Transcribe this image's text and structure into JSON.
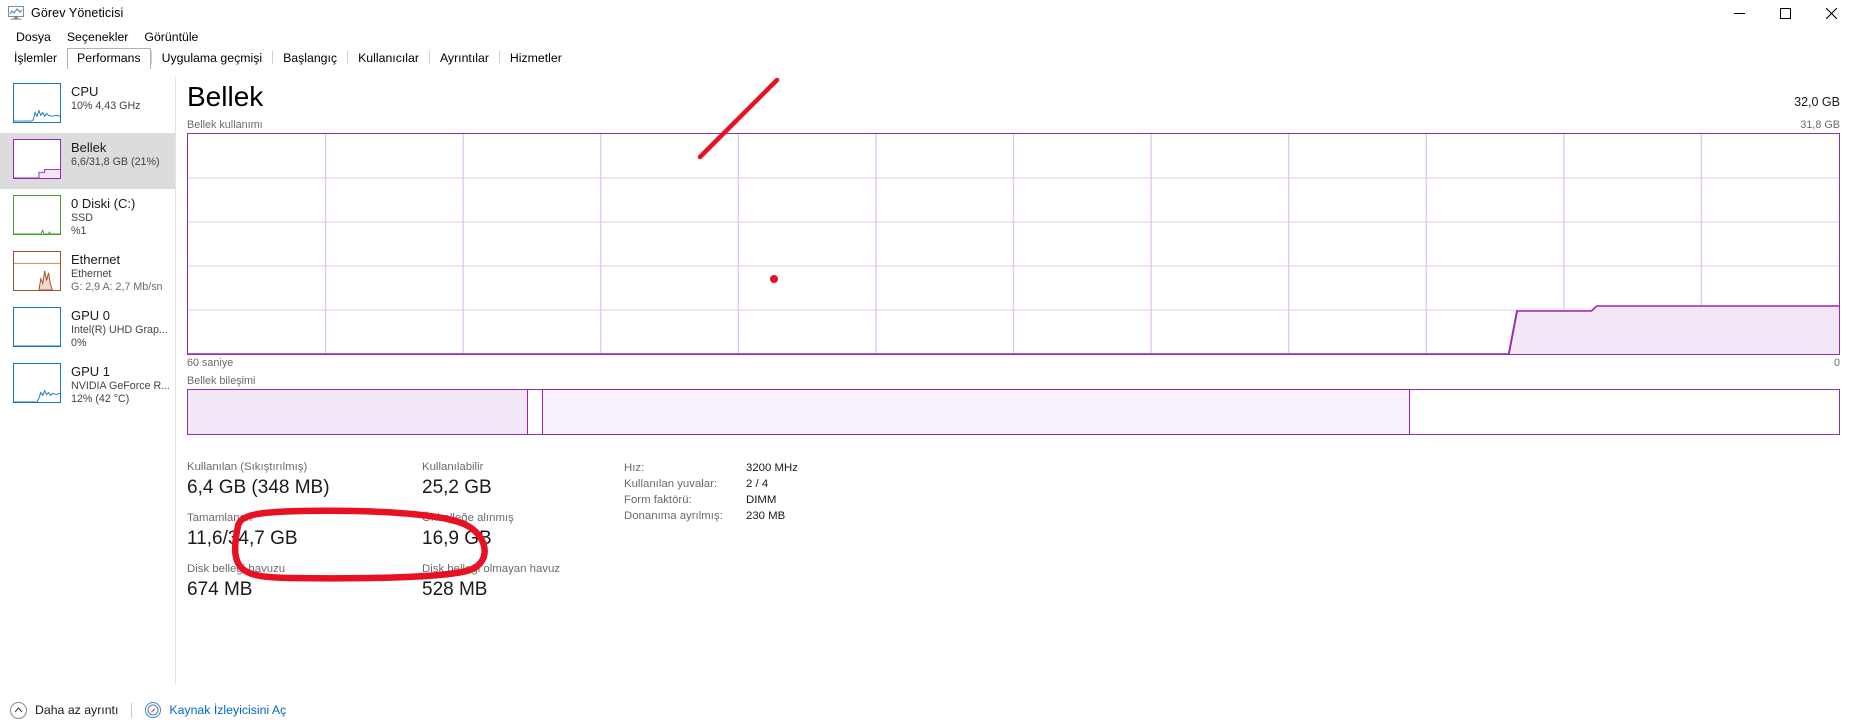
{
  "window": {
    "title": "Görev Yöneticisi",
    "icon": "task-manager-icon",
    "minimize": "—",
    "maximize": "□",
    "close": "✕"
  },
  "menu": {
    "items": [
      {
        "label": "Dosya"
      },
      {
        "label": "Seçenekler"
      },
      {
        "label": "Görüntüle"
      }
    ]
  },
  "tabs": {
    "items": [
      {
        "label": "İşlemler",
        "active": false
      },
      {
        "label": "Performans",
        "active": true
      },
      {
        "label": "Uygulama geçmişi",
        "active": false
      },
      {
        "label": "Başlangıç",
        "active": false
      },
      {
        "label": "Kullanıcılar",
        "active": false
      },
      {
        "label": "Ayrıntılar",
        "active": false
      },
      {
        "label": "Hizmetler",
        "active": false
      }
    ]
  },
  "sidebar": {
    "items": [
      {
        "name": "cpu",
        "title": "CPU",
        "sub1": "10%  4,43 GHz",
        "sub2": "",
        "color": "#1678be",
        "selected": false
      },
      {
        "name": "memory",
        "title": "Bellek",
        "sub1": "6,6/31,8 GB (21%)",
        "sub2": "",
        "color": "#9b26b6",
        "selected": true
      },
      {
        "name": "disk-0",
        "title": "0 Diski (C:)",
        "sub1": "SSD",
        "sub2": "%1",
        "color": "#4a9a28",
        "selected": false
      },
      {
        "name": "ethernet",
        "title": "Ethernet",
        "sub1": "Ethernet",
        "sub2": "G: 2,9 A: 2,7 Mb/sn",
        "color": "#a0522d",
        "selected": false
      },
      {
        "name": "gpu-0",
        "title": "GPU 0",
        "sub1": "Intel(R) UHD Grap...",
        "sub2": "0%",
        "color": "#1678be",
        "selected": false
      },
      {
        "name": "gpu-1",
        "title": "GPU 1",
        "sub1": "NVIDIA GeForce R...",
        "sub2": "12%  (42 °C)",
        "color": "#1678be",
        "selected": false
      }
    ]
  },
  "main": {
    "title": "Bellek",
    "capacity": "32,0 GB",
    "graph_label": "Bellek kullanımı",
    "graph_max": "31,8 GB",
    "axis_left": "60 saniye",
    "axis_right": "0",
    "composition_label": "Bellek bileşimi",
    "accent_color": "#8b2fb6",
    "fill_color": "#f2e6f7"
  },
  "chart_data": {
    "type": "area",
    "title": "Bellek kullanımı",
    "xlabel": "",
    "ylabel": "",
    "ylim": [
      0,
      31.8
    ],
    "xlim": [
      60,
      0
    ],
    "x_tick_labels": [
      "60 saniye",
      "0"
    ],
    "y_tick_labels": [
      "31,8 GB",
      "0"
    ],
    "grid": true,
    "grid_columns": 12,
    "grid_rows": 5,
    "series": [
      {
        "name": "Bellek kullanımı",
        "unit": "GB",
        "values": [
          0.0,
          0.0,
          0.0,
          0.0,
          0.0,
          0.0,
          0.0,
          0.0,
          0.0,
          0.0,
          0.0,
          0.0,
          0.0,
          0.0,
          0.0,
          0.0,
          0.0,
          0.0,
          0.0,
          0.0,
          0.0,
          0.0,
          0.0,
          0.0,
          0.0,
          0.0,
          0.0,
          0.0,
          0.0,
          0.0,
          0.0,
          0.0,
          0.0,
          0.0,
          0.0,
          0.0,
          0.0,
          0.0,
          0.0,
          0.0,
          0.0,
          0.0,
          0.0,
          0.0,
          0.0,
          0.0,
          0.0,
          0.0,
          4.4,
          6.2,
          6.4,
          6.5,
          6.5,
          6.5,
          6.5,
          6.6,
          6.6,
          6.6,
          6.6,
          6.6
        ]
      }
    ]
  },
  "composition": {
    "segments": [
      {
        "name": "in-use",
        "percent": 20.6,
        "fill": "#f2e6f7",
        "border": "#9b26b6"
      },
      {
        "name": "modified",
        "percent": 0.9,
        "fill": "#e4cdf0",
        "border": "#9b26b6"
      },
      {
        "name": "standby",
        "percent": 52.5,
        "fill": "#f2e6f7",
        "border": "#9b26b6"
      },
      {
        "name": "free",
        "percent": 26.0,
        "fill": "#ffffff",
        "border": "#9b26b6"
      }
    ]
  },
  "stats": {
    "rows": [
      {
        "left_key": "Kullanılan (Sıkıştırılmış)",
        "left_value": "6,4 GB (348 MB)",
        "mid_key": "Kullanılabilir",
        "mid_value": "25,2 GB"
      },
      {
        "left_key": "Tamamlanan",
        "left_value": "11,6/34,7 GB",
        "mid_key": "Önbelleğe alınmış",
        "mid_value": "16,9 GB"
      },
      {
        "left_key": "Disk belleği havuzu",
        "left_value": "674 MB",
        "mid_key": "Disk belleği olmayan havuz",
        "mid_value": "528 MB"
      }
    ]
  },
  "specs": {
    "rows": [
      {
        "key": "Hız:",
        "value": "3200 MHz"
      },
      {
        "key": "Kullanılan yuvalar:",
        "value": "2 / 4"
      },
      {
        "key": "Form faktörü:",
        "value": "DIMM"
      },
      {
        "key": "Donanıma ayrılmış:",
        "value": "230 MB"
      }
    ]
  },
  "footer": {
    "chevron": "▲",
    "less_details": "Daha az ayrıntı",
    "resource_monitor": "Kaynak İzleyicisini Aç"
  },
  "annotations": {
    "color": "#e81123",
    "items": [
      {
        "name": "red-arrow-stroke",
        "kind": "line"
      },
      {
        "name": "red-dot-marker",
        "kind": "dot"
      },
      {
        "name": "red-ellipse-highlight",
        "kind": "ellipse"
      }
    ]
  }
}
